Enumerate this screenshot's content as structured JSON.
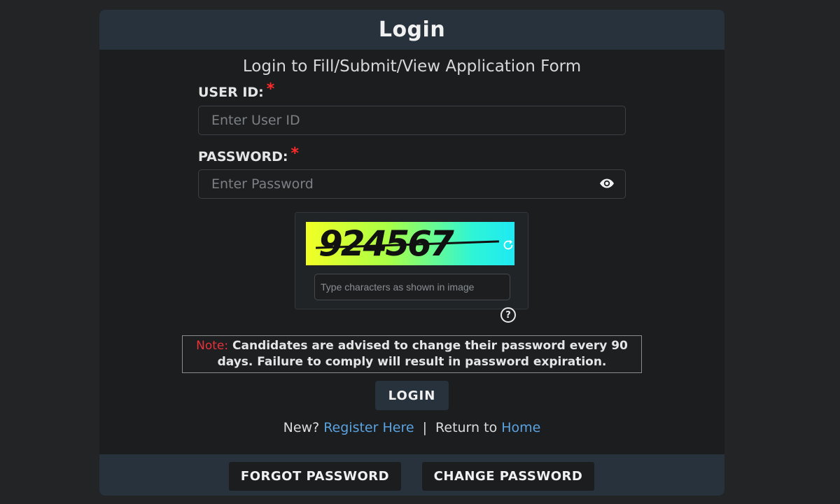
{
  "header": {
    "title": "Login"
  },
  "subtitle": "Login to Fill/Submit/View Application Form",
  "fields": {
    "user_id": {
      "label": "USER ID:",
      "required_mark": "*",
      "placeholder": "Enter User ID",
      "value": ""
    },
    "password": {
      "label": "PASSWORD:",
      "required_mark": "*",
      "placeholder": "Enter Password",
      "value": "",
      "toggle_icon": "eye-icon"
    }
  },
  "captcha": {
    "text": "924567",
    "input_placeholder": "Type characters as shown in image",
    "refresh_icon": "refresh-icon",
    "help_icon": "question-circle-icon",
    "help_glyph": "?"
  },
  "note": {
    "label": "Note:",
    "text": "Candidates are advised to change their password every 90 days. Failure to comply will result in password expiration."
  },
  "login_button": "LOGIN",
  "links": {
    "new_prefix": "New?",
    "register": "Register Here",
    "separator": "|",
    "return_prefix": "Return to",
    "home": "Home"
  },
  "footer": {
    "forgot_password": "FORGOT PASSWORD",
    "change_password": "CHANGE PASSWORD"
  },
  "colors": {
    "header_bg": "#27323d",
    "card_bg": "#1b1d1f",
    "link": "#5ba3e0",
    "required": "#ff2a2a",
    "note_label": "#e8323a"
  }
}
